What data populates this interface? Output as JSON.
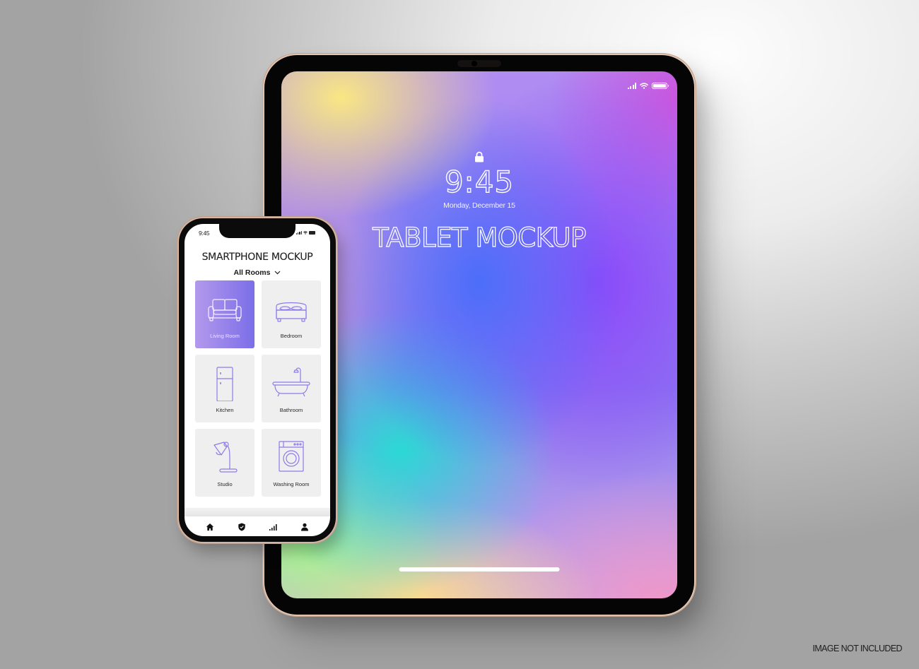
{
  "tablet": {
    "lock_screen": {
      "time": "9:45",
      "date": "Monday, December 15",
      "title": "TABLET MOCKUP"
    },
    "status_icons": [
      "signal-icon",
      "wifi-icon",
      "battery-icon"
    ]
  },
  "phone": {
    "status_time": "9:45",
    "status_icons": [
      "signal-icon",
      "wifi-icon",
      "battery-icon"
    ],
    "app_title": "SMARTPHONE MOCKUP",
    "room_filter": {
      "selected": "All Rooms",
      "icon": "chevron-down-icon"
    },
    "rooms": [
      {
        "label": "Living Room",
        "icon": "sofa-icon",
        "active": true
      },
      {
        "label": "Bedroom",
        "icon": "bed-icon",
        "active": false
      },
      {
        "label": "Kitchen",
        "icon": "fridge-icon",
        "active": false
      },
      {
        "label": "Bathroom",
        "icon": "bathtub-icon",
        "active": false
      },
      {
        "label": "Studio",
        "icon": "desk-lamp-icon",
        "active": false
      },
      {
        "label": "Washing Room",
        "icon": "washing-machine-icon",
        "active": false
      }
    ],
    "tabbar": [
      {
        "name": "home",
        "icon": "home-icon"
      },
      {
        "name": "security",
        "icon": "shield-check-icon"
      },
      {
        "name": "stats",
        "icon": "bar-chart-icon"
      },
      {
        "name": "profile",
        "icon": "user-icon"
      }
    ],
    "colors": {
      "accent_start": "#b399ec",
      "accent_end": "#7b6ee8",
      "icon_stroke": "#8f7ae8"
    }
  },
  "watermark": "IMAGE NOT INCLUDED"
}
